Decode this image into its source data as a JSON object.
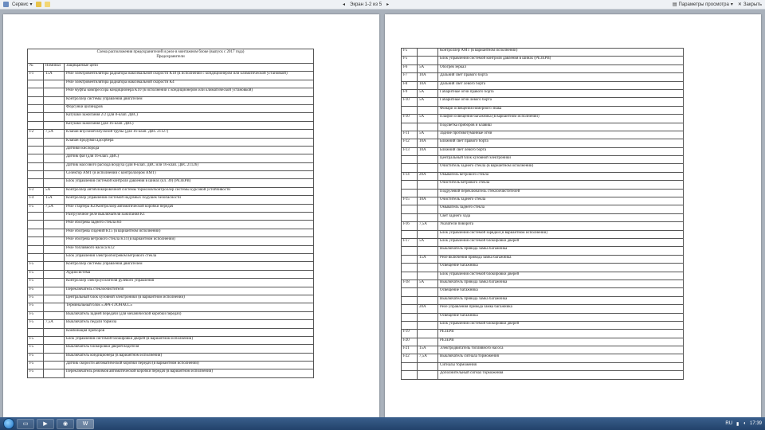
{
  "toolbar": {
    "service_label": "Сервис",
    "page_nav_label": "Экран 1-2 из 5",
    "view_params_label": "Параметры просмотра",
    "close_label": "Закрыть"
  },
  "taskbar": {
    "lang": "RU",
    "time": "17:39"
  },
  "page1": {
    "caption_line1": "Схема расположения предохранителей и реле в монтажном блоке (выпуск с 2017 года)",
    "caption_line2": "Предохранители",
    "header": {
      "num": "№",
      "nominal": "Номинал",
      "circuits": "Защищаемые цепи"
    },
    "rows": [
      {
        "n": "F1",
        "a": "15А",
        "t": "Реле электровентилятора радиатора максимальной скорости K18 (в исполнении с кондиционером или климатической установкой)"
      },
      {
        "n": "",
        "a": "",
        "t": "Реле электровентилятора радиатора максимальной скорости K4"
      },
      {
        "n": "",
        "a": "",
        "t": "Реле муфты компрессора кондиционера K10 (в исполнении с кондиционером или климатической установкой)"
      },
      {
        "n": "",
        "a": "",
        "t": "Контроллер системы управления двигателем"
      },
      {
        "n": "",
        "a": "",
        "t": "Форсунки цилиндров"
      },
      {
        "n": "",
        "a": "",
        "t": "Катушки зажигания 2/2 (для 8-клап. ДВС)"
      },
      {
        "n": "",
        "a": "",
        "t": "Катушки зажигания (для 16-клап. ДВС)"
      },
      {
        "n": "F2",
        "a": "7,5А",
        "t": "Клапан впускной впускной трубы (для 16-клап. ДВС 21127)"
      },
      {
        "n": "",
        "a": "",
        "t": "Клапан продувки адсорбера"
      },
      {
        "n": "",
        "a": "",
        "t": "Датчики кислорода"
      },
      {
        "n": "",
        "a": "",
        "t": "Датчик фаз (для 16-клап. ДВС)"
      },
      {
        "n": "",
        "a": "",
        "t": "Датчик массового расхода воздуха (для 8-клап. ДВС или 16-клап. ДВС 21126)"
      },
      {
        "n": "",
        "a": "",
        "t": "Селектор АМТ (в исполнении с контроллером АМТ)"
      },
      {
        "n": "",
        "a": "",
        "t": "Блок управления системой контроля давления в шинах (кл. 30) (РЕЗЕРВ)"
      },
      {
        "n": "F3",
        "a": "5А",
        "t": "Контроллер антиблокировочной системы тормозов/Контроллер системы курсовой устойчивости"
      },
      {
        "n": "F4",
        "a": "15А",
        "t": "Контроллер управления системой надувных подушек безопасности"
      },
      {
        "n": "F5",
        "a": "7,5А",
        "t": "Реле стартера K2/Контроллер автоматической коробки передач"
      },
      {
        "n": "",
        "a": "",
        "t": "Разгрузочное реле выключателя зажигания K1"
      },
      {
        "n": "",
        "a": "",
        "t": "Реле обогрева заднего стекла K6"
      },
      {
        "n": "",
        "a": "",
        "t": "Реле обогрева сидений K15 (в вариантном исполнении)"
      },
      {
        "n": "",
        "a": "",
        "t": "Реле обогрева ветрового стекла K14 (в вариантном исполнении)"
      },
      {
        "n": "",
        "a": "",
        "t": "Реле топливного насоса K12"
      },
      {
        "n": "",
        "a": "",
        "t": "Блок управления электрообогревом ветрового стекла"
      },
      {
        "n": "F5",
        "a": "",
        "t": "Контроллер системы управления двигателем"
      },
      {
        "n": "F5",
        "a": "",
        "t": "Аудиосистема"
      },
      {
        "n": "F5",
        "a": "",
        "t": "Контроллер электроусилителя рулевого управления"
      },
      {
        "n": "F5",
        "a": "",
        "t": "Переключатель стеклоочистителя"
      },
      {
        "n": "F5",
        "a": "",
        "t": "Центральный блок кузовной электроники (в вариантном исполнении)"
      },
      {
        "n": "F5",
        "a": "",
        "t": "Терминальный блок «ЭРА-ГЛОНАСС»"
      },
      {
        "n": "F5",
        "a": "",
        "t": "Выключатель задней передачи (для механической коробки передач)"
      },
      {
        "n": "F5",
        "a": "7,5А",
        "t": "Выключатель педали тормоза"
      },
      {
        "n": "",
        "a": "",
        "t": "Комбинация приборов"
      },
      {
        "n": "F5",
        "a": "",
        "t": "Блок управления системой блокировки дверей (в вариантном исполнении)"
      },
      {
        "n": "F5",
        "a": "",
        "t": "Выключатель блокировки дверей водителя"
      },
      {
        "n": "F5",
        "a": "",
        "t": "Выключатель кондиционера (в вариантном исполнении)"
      },
      {
        "n": "F5",
        "a": "",
        "t": "Датчик скорости автоматической коробки передач (в вариантном исполнении)"
      },
      {
        "n": "F5",
        "a": "",
        "t": "Переключатель режимов автоматической коробки передач (в вариантном исполнении)"
      }
    ]
  },
  "page2": {
    "rows": [
      {
        "n": "F5",
        "a": "",
        "t": "Контроллер АМТ (в вариантном исполнении)"
      },
      {
        "n": "F5",
        "a": "",
        "t": "Блок управления системой контроля давления в шинах (РЕЗЕРВ)"
      },
      {
        "n": "F6",
        "a": "5А",
        "t": "Обогрев зеркал"
      },
      {
        "n": "F7",
        "a": "10А",
        "t": "Дальний свет правого борта"
      },
      {
        "n": "F8",
        "a": "10А",
        "t": "Дальний свет левого борта"
      },
      {
        "n": "F9",
        "a": "5А",
        "t": "Габаритные огни правого борта"
      },
      {
        "n": "F10",
        "a": "5А",
        "t": "Габаритные огни левого борта"
      },
      {
        "n": "",
        "a": "",
        "t": "Фонари освещения номерного знака"
      },
      {
        "n": "F10",
        "a": "5А",
        "t": "Плафон освещения багажника (в вариантном исполнении)"
      },
      {
        "n": "",
        "a": "",
        "t": "Подсветка приборов и клавиш"
      },
      {
        "n": "F11",
        "a": "5А",
        "t": "Задние противотуманные огни"
      },
      {
        "n": "F12",
        "a": "10А",
        "t": "Ближний свет правого борта"
      },
      {
        "n": "F13",
        "a": "10А",
        "t": "Ближний свет левого борта"
      },
      {
        "n": "",
        "a": "",
        "t": "Центральный блок кузовной электроники"
      },
      {
        "n": "",
        "a": "",
        "t": "Очиститель заднего стекла (в вариантном исполнении)"
      },
      {
        "n": "F14",
        "a": "20А",
        "t": "Омыватель ветрового стекла"
      },
      {
        "n": "",
        "a": "",
        "t": "Очиститель ветрового стекла"
      },
      {
        "n": "",
        "a": "",
        "t": "Подрулевой переключатель стеклоочистителей"
      },
      {
        "n": "F15",
        "a": "10А",
        "t": "Очиститель заднего стекла"
      },
      {
        "n": "",
        "a": "",
        "t": "Омыватель заднего стекла"
      },
      {
        "n": "",
        "a": "",
        "t": "Свет заднего хода"
      },
      {
        "n": "F16",
        "a": "7,5А",
        "t": "Указатели поворота"
      },
      {
        "n": "",
        "a": "",
        "t": "Блок управления системой зарядки (в вариантном исполнении)"
      },
      {
        "n": "F17",
        "a": "5А",
        "t": "Блок управления системой блокировки дверей"
      },
      {
        "n": "",
        "a": "",
        "t": "Выключатель привода замка багажника"
      },
      {
        "n": "",
        "a": "15А",
        "t": "Реле включения привода замка багажника"
      },
      {
        "n": "",
        "a": "",
        "t": "Освещение багажника"
      },
      {
        "n": "",
        "a": "",
        "t": "Блок управления системой блокировки дверей"
      },
      {
        "n": "F18",
        "a": "5А",
        "t": "Выключатель привода замка багажника"
      },
      {
        "n": "",
        "a": "",
        "t": "Освещение багажника"
      },
      {
        "n": "",
        "a": "",
        "t": "Выключатель привода замка багажника"
      },
      {
        "n": "",
        "a": "20А",
        "t": "Реле управления привода замка багажника"
      },
      {
        "n": "",
        "a": "",
        "t": "Освещение багажника"
      },
      {
        "n": "",
        "a": "",
        "t": "Блок управления системой блокировки дверей"
      },
      {
        "n": "F19",
        "a": "",
        "t": "РЕЗЕРВ"
      },
      {
        "n": "F20",
        "a": "",
        "t": "РЕЗЕРВ"
      },
      {
        "n": "F21",
        "a": "15А",
        "t": "Электродвигатель топливного насоса"
      },
      {
        "n": "F22",
        "a": "7,5А",
        "t": "Выключатель сигнала торможения"
      },
      {
        "n": "",
        "a": "",
        "t": "Сигналы торможения"
      },
      {
        "n": "",
        "a": "",
        "t": "Дополнительный сигнал торможения"
      }
    ]
  }
}
